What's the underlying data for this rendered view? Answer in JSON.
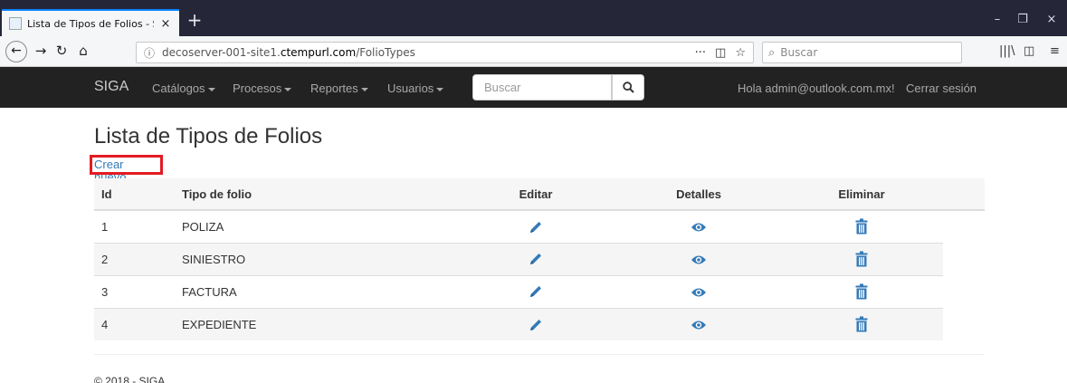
{
  "browser": {
    "tab_title": "Lista de Tipos de Folios - SIGA",
    "tab_close": "×",
    "new_tab": "+",
    "url_scheme_prefix": "decoserver-001-site1.",
    "url_host": "ctempurl.com",
    "url_path": "/FolioTypes",
    "search_placeholder": "Buscar"
  },
  "site_nav": {
    "brand": "SIGA",
    "menus": [
      "Catálogos",
      "Procesos",
      "Reportes",
      "Usuarios"
    ],
    "search_placeholder": "Buscar",
    "greeting": "Hola admin@outlook.com.mx!",
    "logout": "Cerrar sesión"
  },
  "main": {
    "title": "Lista de Tipos de Folios",
    "create_link": "Crear nuevo",
    "columns": [
      "Id",
      "Tipo de folio",
      "Editar",
      "Detalles",
      "Eliminar"
    ],
    "rows": [
      {
        "id": "1",
        "tipo": "POLIZA"
      },
      {
        "id": "2",
        "tipo": "SINIESTRO"
      },
      {
        "id": "3",
        "tipo": "FACTURA"
      },
      {
        "id": "4",
        "tipo": "EXPEDIENTE"
      }
    ]
  },
  "footer": {
    "text": "© 2018 - SIGA"
  },
  "colors": {
    "accent": "#337ab7",
    "highlight_border": "#e31b23",
    "navbar_bg": "#222222",
    "tabstrip_bg": "#252738"
  },
  "icons": {
    "edit": "pencil-icon",
    "details": "eye-icon",
    "delete": "trash-icon"
  }
}
